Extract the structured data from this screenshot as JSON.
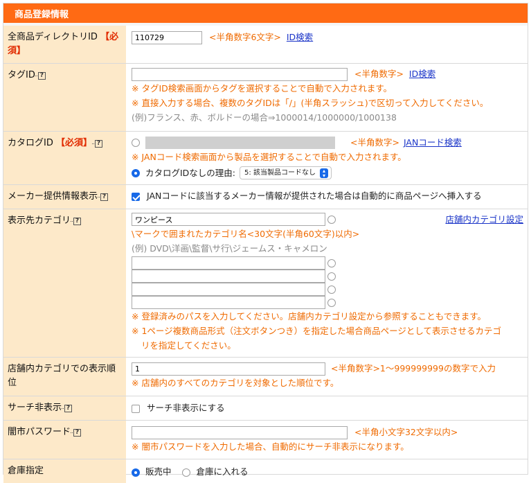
{
  "section": {
    "title": "商品登録情報"
  },
  "directory": {
    "label": "全商品ディレクトリID",
    "required": "【必須】",
    "value": "110729",
    "note": "<半角数字6文字>",
    "link": "ID検索"
  },
  "tag": {
    "label": "タグID",
    "value": "",
    "note": "<半角数字>",
    "link": "ID検索",
    "hint1": "※ タグID検索画面からタグを選択することで自動で入力されます。",
    "hint2": "※ 直接入力する場合、複数のタグIDは「/」(半角スラッシュ)で区切って入力してください。",
    "example": "(例)フランス、赤、ボルドーの場合⇒1000014/1000000/1000138"
  },
  "catalog": {
    "label": "カタログID",
    "required": "【必須】",
    "note": "<半角数字>",
    "link": "JANコード検索",
    "hint": "※ JANコード検索画面から製品を選択することで自動で入力されます。",
    "no_id_label": "カタログIDなしの理由:",
    "reason_selected": "5: 該当製品コードなし"
  },
  "maker": {
    "label": "メーカー提供情報表示",
    "checkbox_label": "JANコードに該当するメーカー情報が提供された場合は自動的に商品ページへ挿入する",
    "checked": true
  },
  "display_category": {
    "label": "表示先カテゴリ",
    "value": "ワンピース",
    "settings_link": "店舗内カテゴリ設定",
    "note": "\\マークで囲まれたカテゴリ名<30文字(半角60文字)以内>",
    "example": "(例) DVD\\洋画\\監督\\サ行\\ジェームス・キャメロン",
    "extra_values": [
      "",
      "",
      "",
      ""
    ],
    "hint1": "※ 登録済みのパスを入力してください。店舗内カテゴリ設定から参照することもできます。",
    "hint2a": "※ 1ページ複数商品形式（注文ボタンつき）を指定した場合商品ページとして表示させるカテゴ",
    "hint2b": "リを指定してください。"
  },
  "display_order": {
    "label": "店舗内カテゴリでの表示順位",
    "value": "1",
    "note": "<半角数字>1～999999999の数字で入力",
    "hint": "※ 店舗内のすべてのカテゴリを対象とした順位です。"
  },
  "search_hide": {
    "label": "サーチ非表示",
    "checkbox_label": "サーチ非表示にする",
    "checked": false
  },
  "black_market": {
    "label": "闇市パスワード",
    "value": "",
    "note": "<半角小文字32文字以内>",
    "hint": "※ 闇市パスワードを入力した場合、自動的にサーチ非表示になります。"
  },
  "warehouse": {
    "label": "倉庫指定",
    "option_sale": "販売中",
    "option_warehouse": "倉庫に入れる",
    "selected": "販売中"
  }
}
